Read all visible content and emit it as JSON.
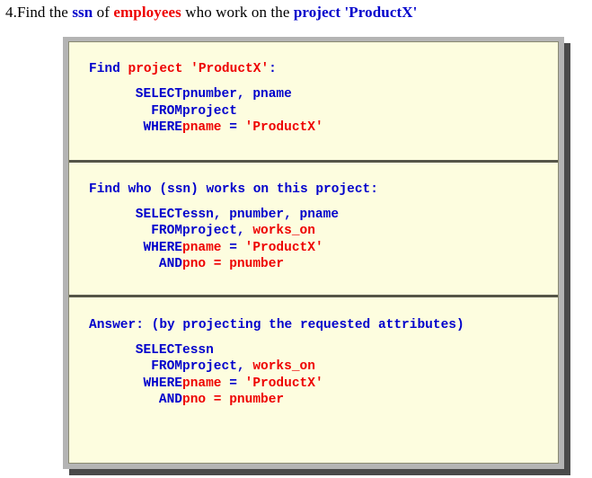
{
  "question": {
    "number": "4.",
    "part1": "Find the ",
    "term_ssn": "ssn",
    "part2": " of ",
    "term_employees": "employees",
    "part3": " who work on the ",
    "term_project": "project 'ProductX'"
  },
  "colors": {
    "keyword_blue": "#0000cc",
    "literal_red": "#ee0000",
    "panel_background": "#fdfddf",
    "panel_bevel": "#b4b4b4",
    "panel_shadow": "#4a4a4a",
    "separator": "#555548",
    "text_black": "#000000"
  },
  "sections": [
    {
      "heading": {
        "lead": "Find ",
        "emphasis": "project 'ProductX'",
        "trail": ":"
      },
      "rows": [
        {
          "keyword": "SELECT",
          "value_parts": [
            {
              "text": "pnumber, pname",
              "color": "blue"
            }
          ]
        },
        {
          "keyword": "FROM",
          "value_parts": [
            {
              "text": "project",
              "color": "blue"
            }
          ]
        },
        {
          "keyword": "WHERE",
          "value_parts": [
            {
              "text": "pname",
              "color": "red"
            },
            {
              "text": " = ",
              "color": "blue"
            },
            {
              "text": "'ProductX'",
              "color": "red"
            }
          ]
        }
      ]
    },
    {
      "heading": {
        "lead": "Find who (ssn) works on this project",
        "emphasis": "",
        "trail": ":"
      },
      "rows": [
        {
          "keyword": "SELECT",
          "value_parts": [
            {
              "text": "essn, pnumber, pname",
              "color": "blue"
            }
          ]
        },
        {
          "keyword": "FROM",
          "value_parts": [
            {
              "text": "project, ",
              "color": "blue"
            },
            {
              "text": "works_on",
              "color": "red"
            }
          ]
        },
        {
          "keyword": "WHERE",
          "value_parts": [
            {
              "text": "pname",
              "color": "red"
            },
            {
              "text": " = ",
              "color": "blue"
            },
            {
              "text": "'ProductX'",
              "color": "red"
            }
          ]
        },
        {
          "keyword": "AND",
          "value_parts": [
            {
              "text": "pno = pnumber",
              "color": "red"
            }
          ]
        }
      ]
    },
    {
      "heading": {
        "lead": "Answer: (by projecting the requested attributes)",
        "emphasis": "",
        "trail": ""
      },
      "rows": [
        {
          "keyword": "SELECT",
          "value_parts": [
            {
              "text": "essn",
              "color": "blue"
            }
          ]
        },
        {
          "keyword": "FROM",
          "value_parts": [
            {
              "text": "project, ",
              "color": "blue"
            },
            {
              "text": "works_on",
              "color": "red"
            }
          ]
        },
        {
          "keyword": "WHERE",
          "value_parts": [
            {
              "text": "pname",
              "color": "red"
            },
            {
              "text": " = ",
              "color": "blue"
            },
            {
              "text": "'ProductX'",
              "color": "red"
            }
          ]
        },
        {
          "keyword": "AND",
          "value_parts": [
            {
              "text": "pno = pnumber",
              "color": "red"
            }
          ]
        }
      ]
    }
  ]
}
